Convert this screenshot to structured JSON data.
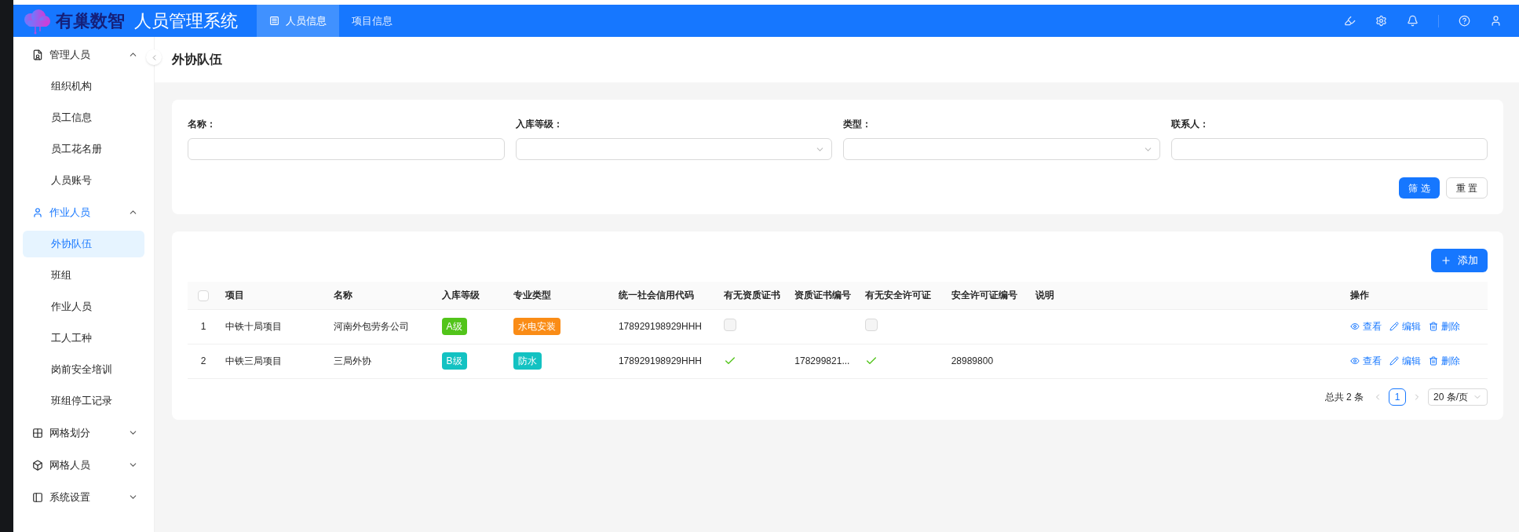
{
  "header": {
    "brand": "有巢数智",
    "title": "人员管理系统",
    "tabs": [
      {
        "label": "人员信息",
        "selected": true
      },
      {
        "label": "项目信息",
        "selected": false
      }
    ]
  },
  "sidebar": {
    "groups": [
      {
        "label": "管理人员",
        "expanded": true,
        "selected": false,
        "children": [
          {
            "label": "组织机构",
            "selected": false
          },
          {
            "label": "员工信息",
            "selected": false
          },
          {
            "label": "员工花名册",
            "selected": false
          },
          {
            "label": "人员账号",
            "selected": false
          }
        ]
      },
      {
        "label": "作业人员",
        "expanded": true,
        "selected": true,
        "children": [
          {
            "label": "外协队伍",
            "selected": true
          },
          {
            "label": "班组",
            "selected": false
          },
          {
            "label": "作业人员",
            "selected": false
          },
          {
            "label": "工人工种",
            "selected": false
          },
          {
            "label": "岗前安全培训",
            "selected": false
          },
          {
            "label": "班组停工记录",
            "selected": false
          }
        ]
      },
      {
        "label": "网格划分",
        "expanded": false,
        "selected": false
      },
      {
        "label": "网格人员",
        "expanded": false,
        "selected": false
      },
      {
        "label": "系统设置",
        "expanded": false,
        "selected": false
      }
    ]
  },
  "page_title": "外协队伍",
  "filters": [
    {
      "label": "名称：",
      "kind": "text"
    },
    {
      "label": "入库等级：",
      "kind": "select"
    },
    {
      "label": "类型：",
      "kind": "select"
    },
    {
      "label": "联系人：",
      "kind": "text"
    }
  ],
  "filter_buttons": {
    "submit": "筛 选",
    "reset": "重 置"
  },
  "add_button": "添加",
  "table": {
    "select_all_checked": false,
    "columns": [
      "项目",
      "名称",
      "入库等级",
      "专业类型",
      "统一社会信用代码",
      "有无资质证书",
      "资质证书编号",
      "有无安全许可证",
      "安全许可证编号",
      "说明",
      "",
      "操作"
    ],
    "rows": [
      {
        "index": "1",
        "project": "中铁十局项目",
        "name": "河南外包劳务公司",
        "level": {
          "text": "A级",
          "color": "#52c41a"
        },
        "type": {
          "text": "水电安装",
          "color": "#fa8c16"
        },
        "credit_code": "178929198929HHH",
        "has_qualification": false,
        "has_safety_license": false,
        "actions": [
          "查看",
          "编辑",
          "删除"
        ]
      },
      {
        "index": "2",
        "project": "中铁三局项目",
        "name": "三局外协",
        "level": {
          "text": "B级",
          "color": "#13c2c2"
        },
        "type": {
          "text": "防水",
          "color": "#13c2c2"
        },
        "credit_code": "178929198929HHH",
        "has_qualification": true,
        "qualification_no": "178299821...",
        "has_safety_license": true,
        "safety_license_no": "28989800",
        "actions": [
          "查看",
          "编辑",
          "删除"
        ]
      }
    ]
  },
  "pagination": {
    "total": "总共 2 条",
    "pages": [
      {
        "label": "1",
        "selected": true
      }
    ],
    "page_size": "20 条/页"
  }
}
